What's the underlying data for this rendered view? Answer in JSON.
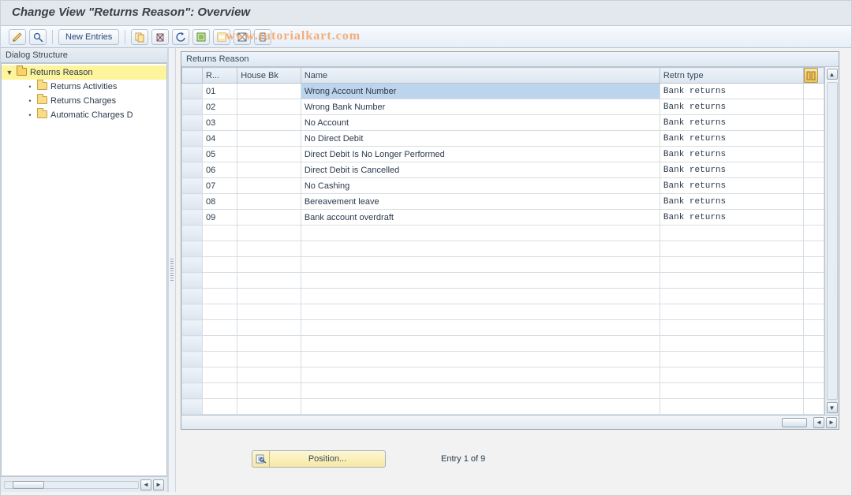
{
  "title": "Change View \"Returns Reason\": Overview",
  "watermark": "www.tutorialkart.com",
  "toolbar": {
    "new_entries_label": "New Entries"
  },
  "sidebar": {
    "header": "Dialog Structure",
    "items": [
      {
        "label": "Returns Reason",
        "level": 1,
        "expanded": true,
        "selected": true
      },
      {
        "label": "Returns Activities",
        "level": 2,
        "expanded": false,
        "selected": false
      },
      {
        "label": "Returns Charges",
        "level": 2,
        "expanded": false,
        "selected": false
      },
      {
        "label": "Automatic Charges D",
        "level": 2,
        "expanded": false,
        "selected": false
      }
    ]
  },
  "table": {
    "caption": "Returns Reason",
    "columns": {
      "r": "R...",
      "house_bk": "House Bk",
      "name": "Name",
      "retrn_type": "Retrn type"
    },
    "rows": [
      {
        "r": "01",
        "house_bk": "",
        "name": "Wrong Account Number",
        "retrn_type": "Bank returns",
        "name_selected": true
      },
      {
        "r": "02",
        "house_bk": "",
        "name": "Wrong Bank Number",
        "retrn_type": "Bank returns"
      },
      {
        "r": "03",
        "house_bk": "",
        "name": "No Account",
        "retrn_type": "Bank returns"
      },
      {
        "r": "04",
        "house_bk": "",
        "name": "No Direct Debit",
        "retrn_type": "Bank returns"
      },
      {
        "r": "05",
        "house_bk": "",
        "name": "Direct Debit Is No Longer Performed",
        "retrn_type": "Bank returns"
      },
      {
        "r": "06",
        "house_bk": "",
        "name": "Direct Debit is Cancelled",
        "retrn_type": "Bank returns"
      },
      {
        "r": "07",
        "house_bk": "",
        "name": "No Cashing",
        "retrn_type": "Bank returns"
      },
      {
        "r": "08",
        "house_bk": "",
        "name": "Bereavement leave",
        "retrn_type": "Bank returns"
      },
      {
        "r": "09",
        "house_bk": "",
        "name": "Bank account overdraft",
        "retrn_type": "Bank returns"
      }
    ],
    "empty_rows": 12
  },
  "footer": {
    "position_label": "Position...",
    "entry_text": "Entry 1 of 9"
  }
}
